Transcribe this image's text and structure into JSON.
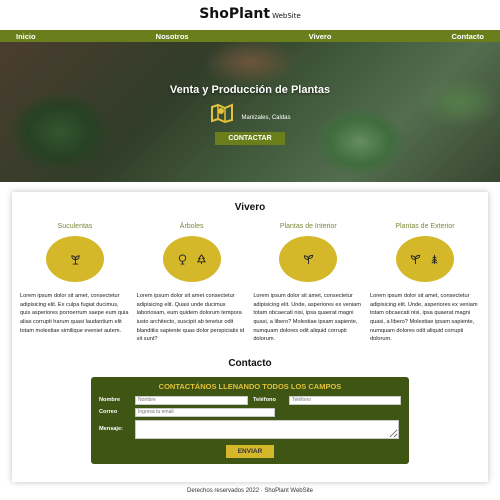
{
  "header": {
    "brand": "ShoPlant",
    "brand_suffix": "WebSite"
  },
  "nav": [
    "Inicio",
    "Nosotros",
    "Vivero",
    "Contacto"
  ],
  "hero": {
    "title": "Venta y Producción de Plantas",
    "location": "Manizales, Caldas",
    "cta": "CONTACTAR"
  },
  "vivero": {
    "title": "Vivero",
    "categories": [
      {
        "name": "Suculentas",
        "icons": [
          "plant-icon"
        ],
        "text": "Lorem ipsum dolor sit amet, consectetur adipisicing elit. Ex culpa fugiat ducimus, quis asperiores porroerrum saepe eum quia alias corrupti harum quasi laudantium elit totam molestiae similique eveniet autem."
      },
      {
        "name": "Árboles",
        "icons": [
          "tree-icon",
          "pine-tree-icon"
        ],
        "text": "Lorem ipsum dolor sit amet consectetur adipisicing elit. Quasi unde ducimus laboriosam, eum quidem dolorum tempora iusto architecto, suscipit ab tenetur odit blanditiis sapiente quas dolor perspiciatis id sit sunt?"
      },
      {
        "name": "Plantas de Interior",
        "icons": [
          "seedling-icon"
        ],
        "text": "Lorem ipsum dolor sit amet, consectetur adipisicing elit. Unde, asperiores ex veniam totam obcaecati nisi, ipsa quaerat magni quasi, a libero? Molestiae ipsam sapiente, numquam dolores odit aliquid corrupti dolorum."
      },
      {
        "name": "Plantas de Exterior",
        "icons": [
          "seedling-icon",
          "pine-tree-icon"
        ],
        "text": "Lorem ipsum dolor sit amet, consectetur adipisicing elit. Unde, asperiores ex veniam totam obcaecati nisi, ipsa quaerat magni quasi, a libero? Molestiae ipsam sapiente, numquam dolores odit aliquid corrupti dolorum."
      }
    ]
  },
  "contact": {
    "title": "Contacto",
    "form_title": "CONTACTÁNOS LLENANDO TODOS LOS CAMPOS",
    "name_label": "Nombre",
    "name_placeholder": "Nombre",
    "phone_label": "Teléfono",
    "phone_placeholder": "Teléfono",
    "email_label": "Correo",
    "email_placeholder": "Ingresa tu email",
    "message_label": "Mensaje:",
    "send": "ENVIAR"
  },
  "footer": "Derechos reservados 2022 · ShoPlant WebSite",
  "colors": {
    "accent_green": "#6b7e1c",
    "form_green": "#3f5514",
    "gold": "#d4b82a"
  }
}
